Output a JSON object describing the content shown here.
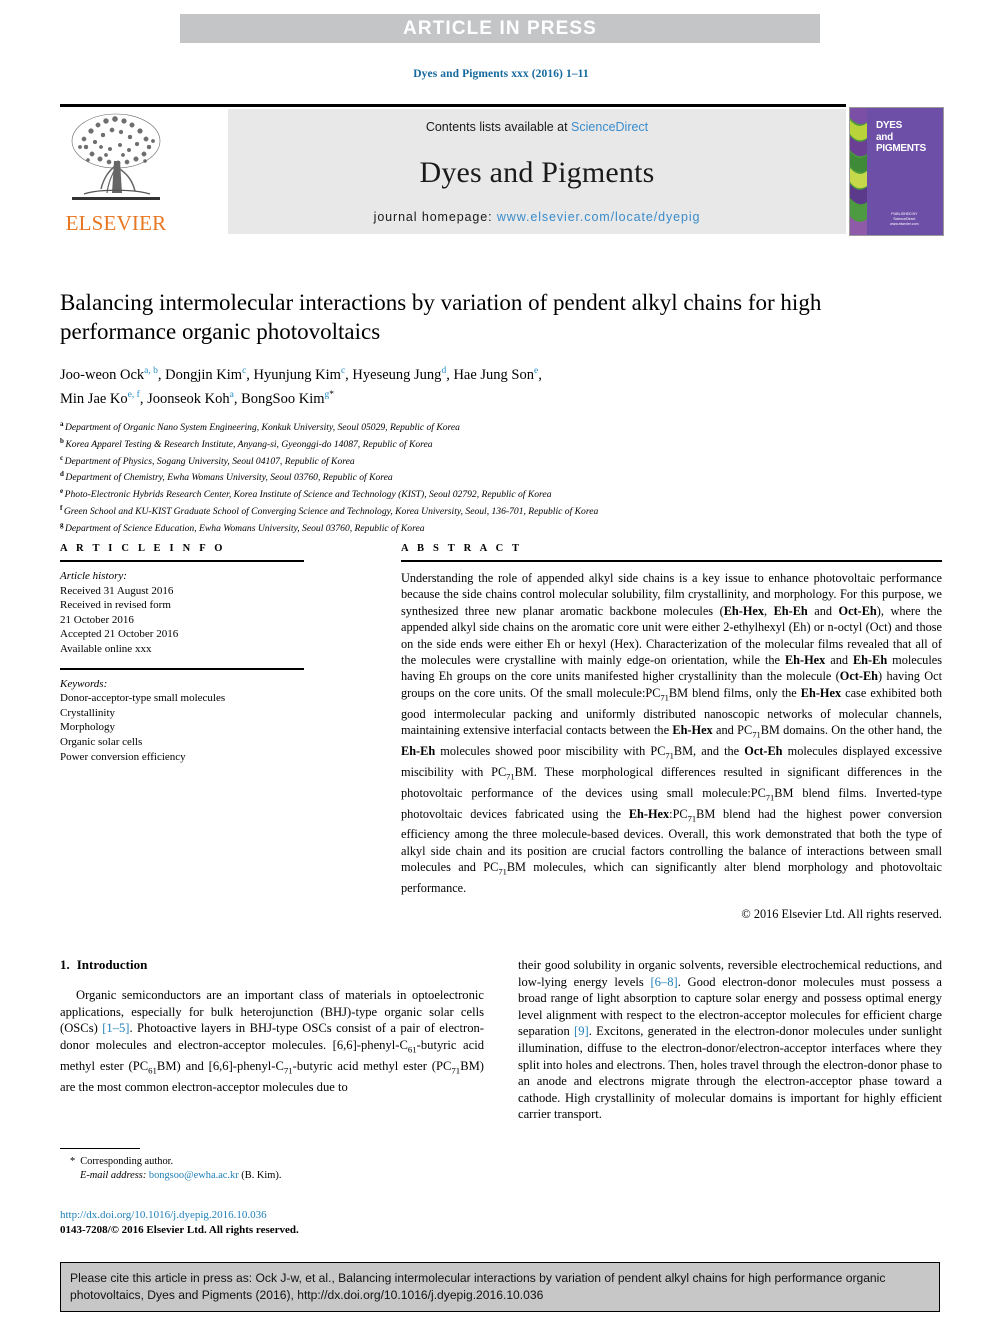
{
  "banner": {
    "label": "ARTICLE IN PRESS"
  },
  "running_head": "Dyes and Pigments xxx (2016) 1–11",
  "masthead": {
    "contents_prefix": "Contents lists available at ",
    "contents_link": "ScienceDirect",
    "journal_name": "Dyes and Pigments",
    "homepage_prefix": "journal homepage: ",
    "homepage_link": "www.elsevier.com/locate/dyepig",
    "publisher": "ELSEVIER",
    "cover_title": "DYES\nand\nPIGMENTS",
    "cover_footer": "PUBLISHED BY\nScienceDirect\nwww.elsevier.com/locate/dyepig"
  },
  "title": "Balancing intermolecular interactions by variation of pendent alkyl chains for high performance organic photovoltaics",
  "authors": [
    {
      "name": "Joo-weon Ock",
      "marks": "a, b",
      "sep": ", "
    },
    {
      "name": "Dongjin Kim",
      "marks": "c",
      "sep": ", "
    },
    {
      "name": "Hyunjung Kim",
      "marks": "c",
      "sep": ", "
    },
    {
      "name": "Hyeseung Jung",
      "marks": "d",
      "sep": ", "
    },
    {
      "name": "Hae Jung Son",
      "marks": "e",
      "sep": ", "
    },
    {
      "name": "Min Jae Ko",
      "marks": "e, f",
      "sep": ", "
    },
    {
      "name": "Joonseok Koh",
      "marks": "a",
      "sep": ", "
    },
    {
      "name": "BongSoo Kim",
      "marks": "g",
      "star": "*",
      "sep": ""
    }
  ],
  "affiliations": [
    {
      "mark": "a",
      "text": "Department of Organic Nano System Engineering, Konkuk University, Seoul 05029, Republic of Korea"
    },
    {
      "mark": "b",
      "text": "Korea Apparel Testing & Research Institute, Anyang-si, Gyeonggi-do 14087, Republic of Korea"
    },
    {
      "mark": "c",
      "text": "Department of Physics, Sogang University, Seoul 04107, Republic of Korea"
    },
    {
      "mark": "d",
      "text": "Department of Chemistry, Ewha Womans University, Seoul 03760, Republic of Korea"
    },
    {
      "mark": "e",
      "text": "Photo-Electronic Hybrids Research Center, Korea Institute of Science and Technology (KIST), Seoul 02792, Republic of Korea"
    },
    {
      "mark": "f",
      "text": "Green School and KU-KIST Graduate School of Converging Science and Technology, Korea University, Seoul, 136-701, Republic of Korea"
    },
    {
      "mark": "g",
      "text": "Department of Science Education, Ewha Womans University, Seoul 03760, Republic of Korea"
    }
  ],
  "article_info": {
    "heading": "A R T I C L E   I N F O",
    "history_label": "Article history:",
    "history_lines": [
      "Received 31 August 2016",
      "Received in revised form",
      "21 October 2016",
      "Accepted 21 October 2016",
      "Available online xxx"
    ],
    "keywords_label": "Keywords:",
    "keywords": [
      "Donor-acceptor-type small molecules",
      "Crystallinity",
      "Morphology",
      "Organic solar cells",
      "Power conversion efficiency"
    ]
  },
  "abstract": {
    "heading": "A B S T R A C T",
    "copyright": "© 2016 Elsevier Ltd. All rights reserved."
  },
  "introduction": {
    "number": "1.",
    "heading": "Introduction"
  },
  "footnote": {
    "star": "*",
    "corresponding": "Corresponding author.",
    "email_label": "E-mail address:",
    "email": "bongsoo@ewha.ac.kr",
    "email_owner": "(B. Kim)."
  },
  "doi": {
    "url": "http://dx.doi.org/10.1016/j.dyepig.2016.10.036",
    "issn_line": "0143-7208/© 2016 Elsevier Ltd. All rights reserved."
  },
  "cite_box": {
    "text": "Please cite this article in press as: Ock J-w, et al., Balancing intermolecular interactions by variation of pendent alkyl chains for high performance organic photovoltaics, Dyes and Pigments (2016), http://dx.doi.org/10.1016/j.dyepig.2016.10.036"
  },
  "colors": {
    "banner_gray": "#c3c5c7",
    "link_blue": "#1f7fb8",
    "sciencedirect_blue": "#3a8ccc",
    "elsevier_orange": "#e87722",
    "cover_purple": "#6d4fa8",
    "cite_box_gray": "#c7c7c7"
  }
}
